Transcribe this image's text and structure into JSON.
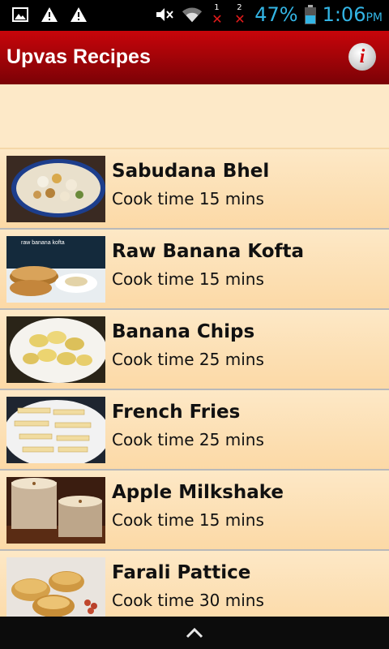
{
  "status_bar": {
    "battery": "47%",
    "time": "1:06",
    "ampm": "PM",
    "sim1": "1",
    "sim2": "2",
    "icons": [
      "image-icon",
      "warning-icon",
      "warning-icon",
      "mute-icon",
      "wifi-icon",
      "sim-x-icon",
      "sim-x-icon",
      "battery-icon"
    ]
  },
  "app": {
    "title": "Upvas Recipes",
    "info_label": "i",
    "accent": "#c8050a"
  },
  "recipes": [
    {
      "name": "Sabudana Bhel",
      "time": "Cook time 15 mins"
    },
    {
      "name": "Raw Banana Kofta",
      "time": "Cook time 15 mins",
      "thumb_caption": "raw banana kofta"
    },
    {
      "name": "Banana Chips",
      "time": "Cook time 25 mins"
    },
    {
      "name": "French Fries",
      "time": "Cook time 25 mins"
    },
    {
      "name": "Apple Milkshake",
      "time": "Cook time 15 mins"
    },
    {
      "name": "Farali Pattice",
      "time": "Cook time 30 mins"
    }
  ]
}
